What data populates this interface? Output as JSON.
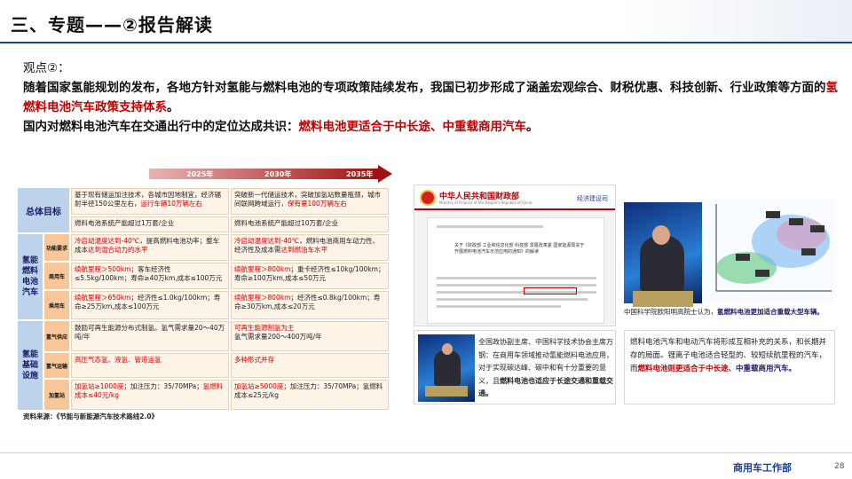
{
  "header": {
    "title": "三、专题——②报告解读"
  },
  "intro": {
    "label": "观点②：",
    "p1_a": "随着国家氢能规划的发布，各地方针对氢能与燃料电池的专项政策陆续发布，我国已初步形成了涵盖宏观综合、财税优惠、科技创新、行业政策等方面的",
    "p1_hl": "氢燃料电池汽车政策支持体系",
    "p1_end": "。",
    "p2_a": "国内对燃料电池汽车在交通出行中的定位达成共识：",
    "p2_hl": "燃料电池更适合于中长途、中重载商用汽车",
    "p2_end": "。"
  },
  "roadmap": {
    "years": [
      "2025年",
      "2030年",
      "2035年"
    ],
    "overall": {
      "label": "总体目标",
      "c1_a": "基于现有储运加注技术，各城市因地制宜，经济辐射半径150公里左右，",
      "c1_r": "运行车辆10万辆左右",
      "c1_b": "燃料电池系统产能超过1万套/企业",
      "c2_a": "突破新一代储运技术，突破加氢站数量瓶颈，城市间联网跨域运行，",
      "c2_r": "保有量100万辆左右",
      "c2_b": "燃料电池系统产能超过10万套/企业"
    },
    "fcv": {
      "label": "氢能燃料电池汽车",
      "subs": [
        "功能要求",
        "商用车",
        "乘用车"
      ],
      "r1c1_r": "冷启动温度达到-40℃",
      "r1c1_a": "，提高燃料电池功率；整车成本",
      "r1c1_r2": "达到混合动力的水平",
      "r1c2_r": "冷启动温度达到-40℃",
      "r1c2_a": "，燃料电池商用车动力性、经济性及成本需",
      "r1c2_r2": "达到燃油车水平",
      "r2c1_r": "续航里程＞500km",
      "r2c1_a": "；客车经济性≤5.5kg/100km；寿命≥40万km,成本≤100万元",
      "r2c2_r": "续航里程＞800km",
      "r2c2_a": "；重卡经济性≤10kg/100km；寿命≥100万km,成本≤50万元",
      "r3c1_r": "续航里程＞650km",
      "r3c1_a": "；经济性≤1.0kg/100km；寿命≥25万km,成本≤100万元",
      "r3c2_r": "续航里程＞800km",
      "r3c2_a": "；经济性≤0.8kg/100km；寿命≥30万km,成本≤20万元"
    },
    "infra": {
      "label": "氢能基础设施",
      "subs": [
        "氢气供应",
        "氢气运输",
        "加氢站"
      ],
      "r1c1": "鼓励可再生能源分布式制氢。氢气需求量20～40万吨/年",
      "r1c2_r": "可再生能源制氢为主",
      "r1c2_a": "氢气需求量200～400万吨/年",
      "r2c1": "高压气态氢、液氢、管道运氢",
      "r2c2": "多种形式并存",
      "r3c1_r": "加氢站≥1000座",
      "r3c1_a": "；加注压力：35/70MPa；",
      "r3c1_r2": "氢燃料成本≤40元/kg",
      "r3c2_r": "加氢站≥5000座",
      "r3c2_a": "；加注压力：35/70MPa；氢燃料成本≤25元/kg"
    },
    "source": "资料来源：《节能与新能源汽车技术路线2.0》"
  },
  "mof": {
    "name": "中华人民共和国财政部",
    "en": "Ministry of Finance of the People's Republic of China",
    "dept": "经济建设司",
    "doc_title": "关于《财政部 工业和信息化部 科技部 发展改革委 国家能源局关于开展燃料电池汽车示范应用的通知》的解读"
  },
  "tv": {
    "caption_a": "中国科学院欧阳明高院士认为，",
    "caption_b": "氢燃料电池更加适合重载大型车辆。"
  },
  "cae": {
    "text_a": "全国政协副主席、中国科学技术协会主席万钢：在商用车领域推动氢能燃料电池应用，对于实现碳达峰、碳中和有十分重要的意义，且",
    "text_b": "燃料电池也适应于长途交通和重载交通。"
  },
  "note": {
    "text_a": "燃料电池汽车和电动汽车将形成互相补充的关系，和长期并存的局面。锂离子电池适合轻型的、较短续航里程的汽车，而",
    "text_r": "燃料电池则更适合于中长途、",
    "text_b": "中重载商用汽车。"
  },
  "footer": {
    "dept": "商用车工作部",
    "page": "28"
  }
}
